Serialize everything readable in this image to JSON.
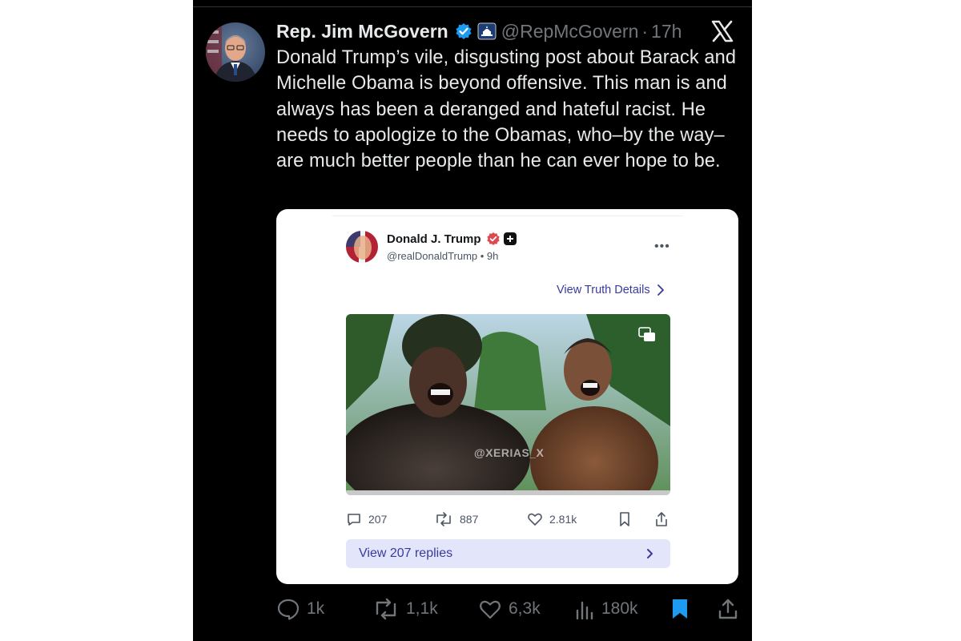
{
  "tweet": {
    "author_name": "Rep. Jim McGovern",
    "handle": "@RepMcGovern",
    "separator": "·",
    "time": "17h",
    "text": "Donald Trump’s vile, disgusting post about Barack and Michelle Obama is beyond offensive. This man is and always has been a deranged and hateful racist. He needs to apologize to the Obamas, who–by the way–are much better people than he can ever hope to be.",
    "actions": {
      "replies": "1k",
      "reposts": "1,1k",
      "likes": "6,3k",
      "views": "180k"
    },
    "icons": [
      "verified-icon",
      "capitol-icon",
      "x-logo-icon",
      "reply-icon",
      "repost-icon",
      "like-icon",
      "views-icon",
      "bookmark-icon",
      "share-icon"
    ]
  },
  "embedded_post": {
    "author_name": "Donald J. Trump",
    "handle_time": "@realDonaldTrump • 9h",
    "more": "•••",
    "details_link": "View Truth Details",
    "watermark": "@XERIAS_X",
    "actions": {
      "replies": "207",
      "reposts": "887",
      "likes": "2.81k"
    },
    "view_replies": "View 207 replies"
  },
  "colors": {
    "background": "#000000",
    "text": "#e7e9ea",
    "muted": "#71767b",
    "bookmark_active": "#1d9bf0",
    "verified": "#1d9bf0",
    "truth_link": "#3a3a9e",
    "truth_reply_bg": "#e3e6fb"
  }
}
